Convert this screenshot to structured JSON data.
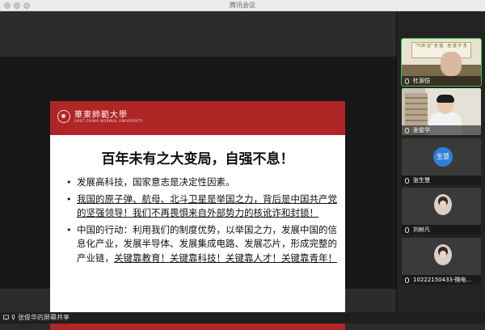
{
  "window": {
    "title": "腾讯会议"
  },
  "slide": {
    "logo": {
      "cn": "華東師範大學",
      "en": "EAST CHINA NORMAL UNIVERSITY"
    },
    "title": "百年未有之大变局，自强不息！",
    "bullets": [
      {
        "text": "发展高科技，国家意志是决定性因素。"
      },
      {
        "text": "我国的原子弹、航母、北斗卫星是举国之力，背后是中国共产党的坚强领导！我们不再畏惧来自外部势力的核讹诈和封锁！"
      },
      {
        "text_a": "中国的行动：利用我们的制度优势，以举国之力，发展中国的信息化产业，发展半导体、发展集成电路、发展芯片，形成完整的产业链，",
        "text_b": "关键靠教育！关键靠科技！关键靠人才！关键靠青年！"
      }
    ]
  },
  "participants": [
    {
      "name": "杜源恺",
      "type": "camera",
      "sign": "\"YUE·证\" 全 程 · 自 强 不 息"
    },
    {
      "name": "张俊华",
      "type": "camera"
    },
    {
      "name": "张生慧",
      "type": "avatar",
      "avatar_text": "生慧",
      "avatar_color": "#2f7fd9"
    },
    {
      "name": "刘树凡",
      "type": "photo"
    },
    {
      "name": "10222150433-微电...",
      "type": "photo"
    }
  ],
  "bottom": {
    "share_label": "张俊华的屏幕共享"
  },
  "colors": {
    "slide_accent": "#b02525",
    "active_speaker": "#3fbf4a"
  }
}
